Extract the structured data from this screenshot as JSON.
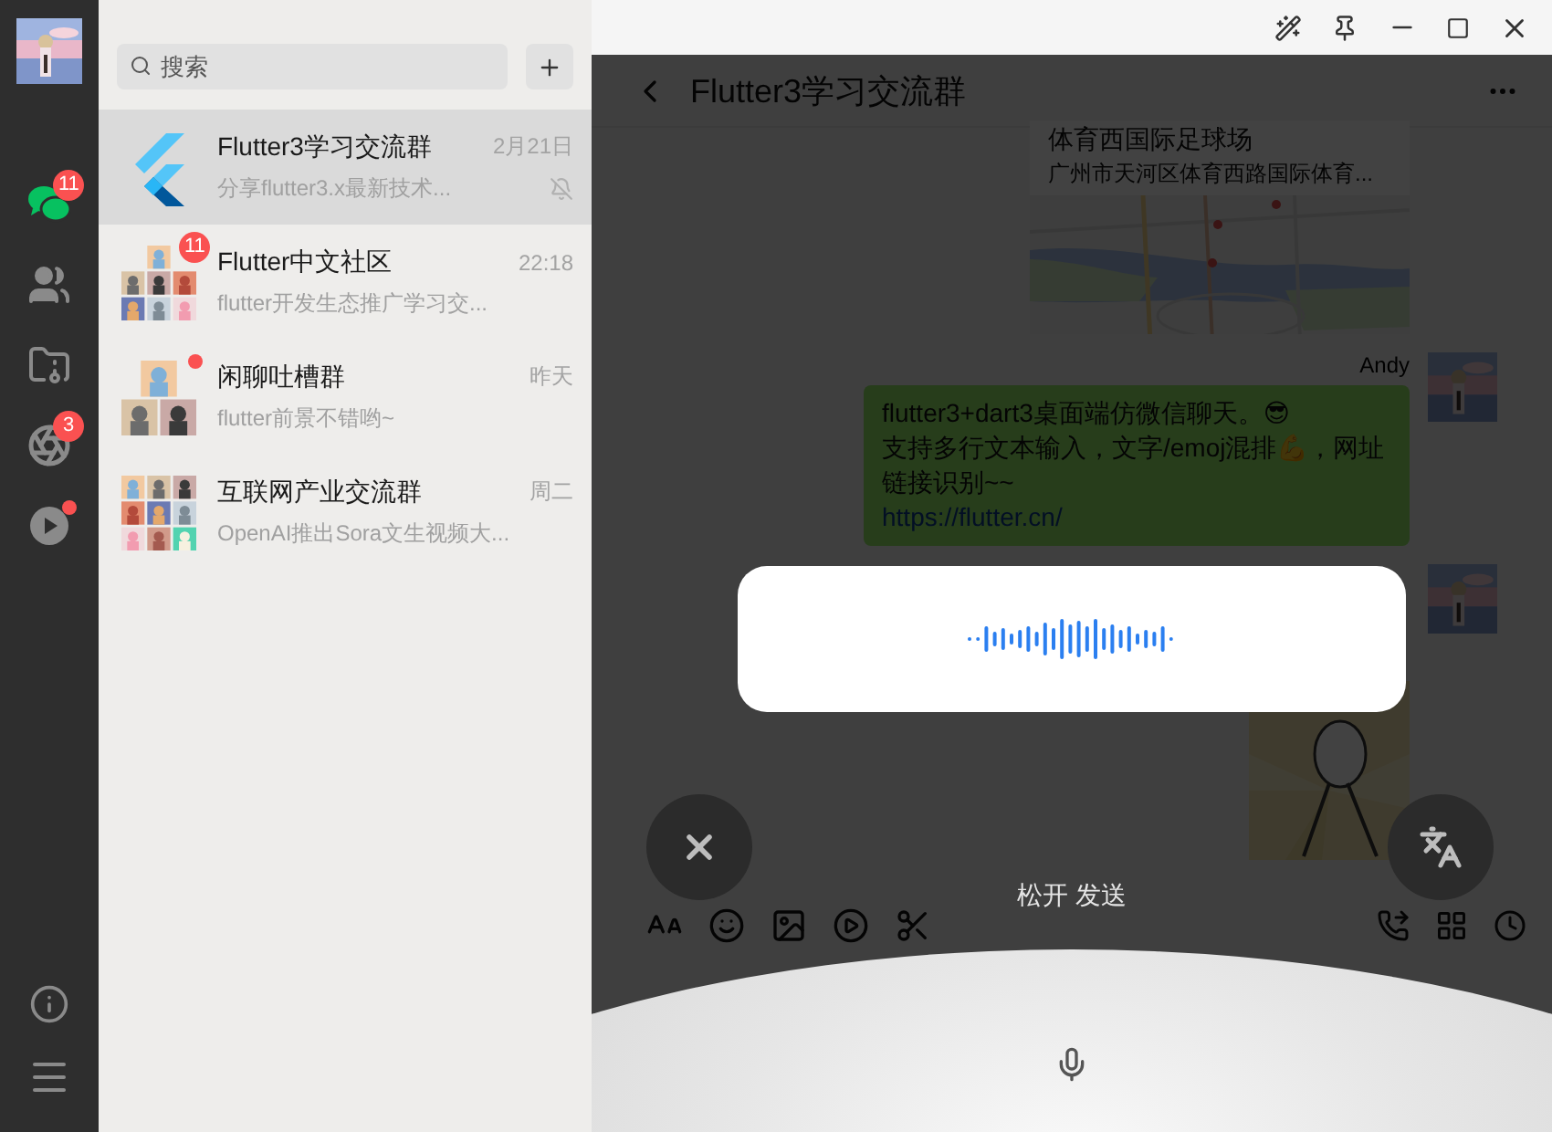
{
  "rail": {
    "items": [
      {
        "kind": "chats",
        "selected": true,
        "badge": "11"
      },
      {
        "kind": "contacts",
        "selected": false
      },
      {
        "kind": "files",
        "selected": false
      },
      {
        "kind": "moments",
        "selected": false,
        "badge": "3"
      },
      {
        "kind": "videos",
        "selected": false,
        "unread_dot": true
      }
    ]
  },
  "search": {
    "placeholder": "搜索"
  },
  "chats": [
    {
      "name": "Flutter3学习交流群",
      "preview": "分享flutter3.x最新技术...",
      "time": "2月21日",
      "selected": true,
      "muted": true,
      "avatar": {
        "kind": "logo"
      }
    },
    {
      "name": "Flutter中文社区",
      "preview": "flutter开发生态推广学习交...",
      "time": "22:18",
      "selected": false,
      "badge": "11",
      "avatar": {
        "kind": "group"
      }
    },
    {
      "name": "闲聊吐槽群",
      "preview": "flutter前景不错哟~",
      "time": "昨天",
      "selected": false,
      "unread_dot": true,
      "avatar": {
        "kind": "group"
      }
    },
    {
      "name": "互联网产业交流群",
      "preview": "OpenAI推出Sora文生视频大...",
      "time": "周二",
      "selected": false,
      "avatar": {
        "kind": "group"
      }
    }
  ],
  "chat": {
    "title": "Flutter3学习交流群",
    "messages": [
      {
        "kind": "location",
        "title": "体育西国际足球场",
        "address": "广州市天河区体育西路国际体育..."
      },
      {
        "kind": "text",
        "sender": "Andy",
        "lines": [
          "flutter3+dart3桌面端仿微信聊天。😎",
          "支持多行文本输入，文字/emoj混排💪，网址链接识别~~"
        ],
        "link": "https://flutter.cn/"
      },
      {
        "kind": "sticker"
      }
    ]
  },
  "voice": {
    "hint": "松开 发送"
  }
}
